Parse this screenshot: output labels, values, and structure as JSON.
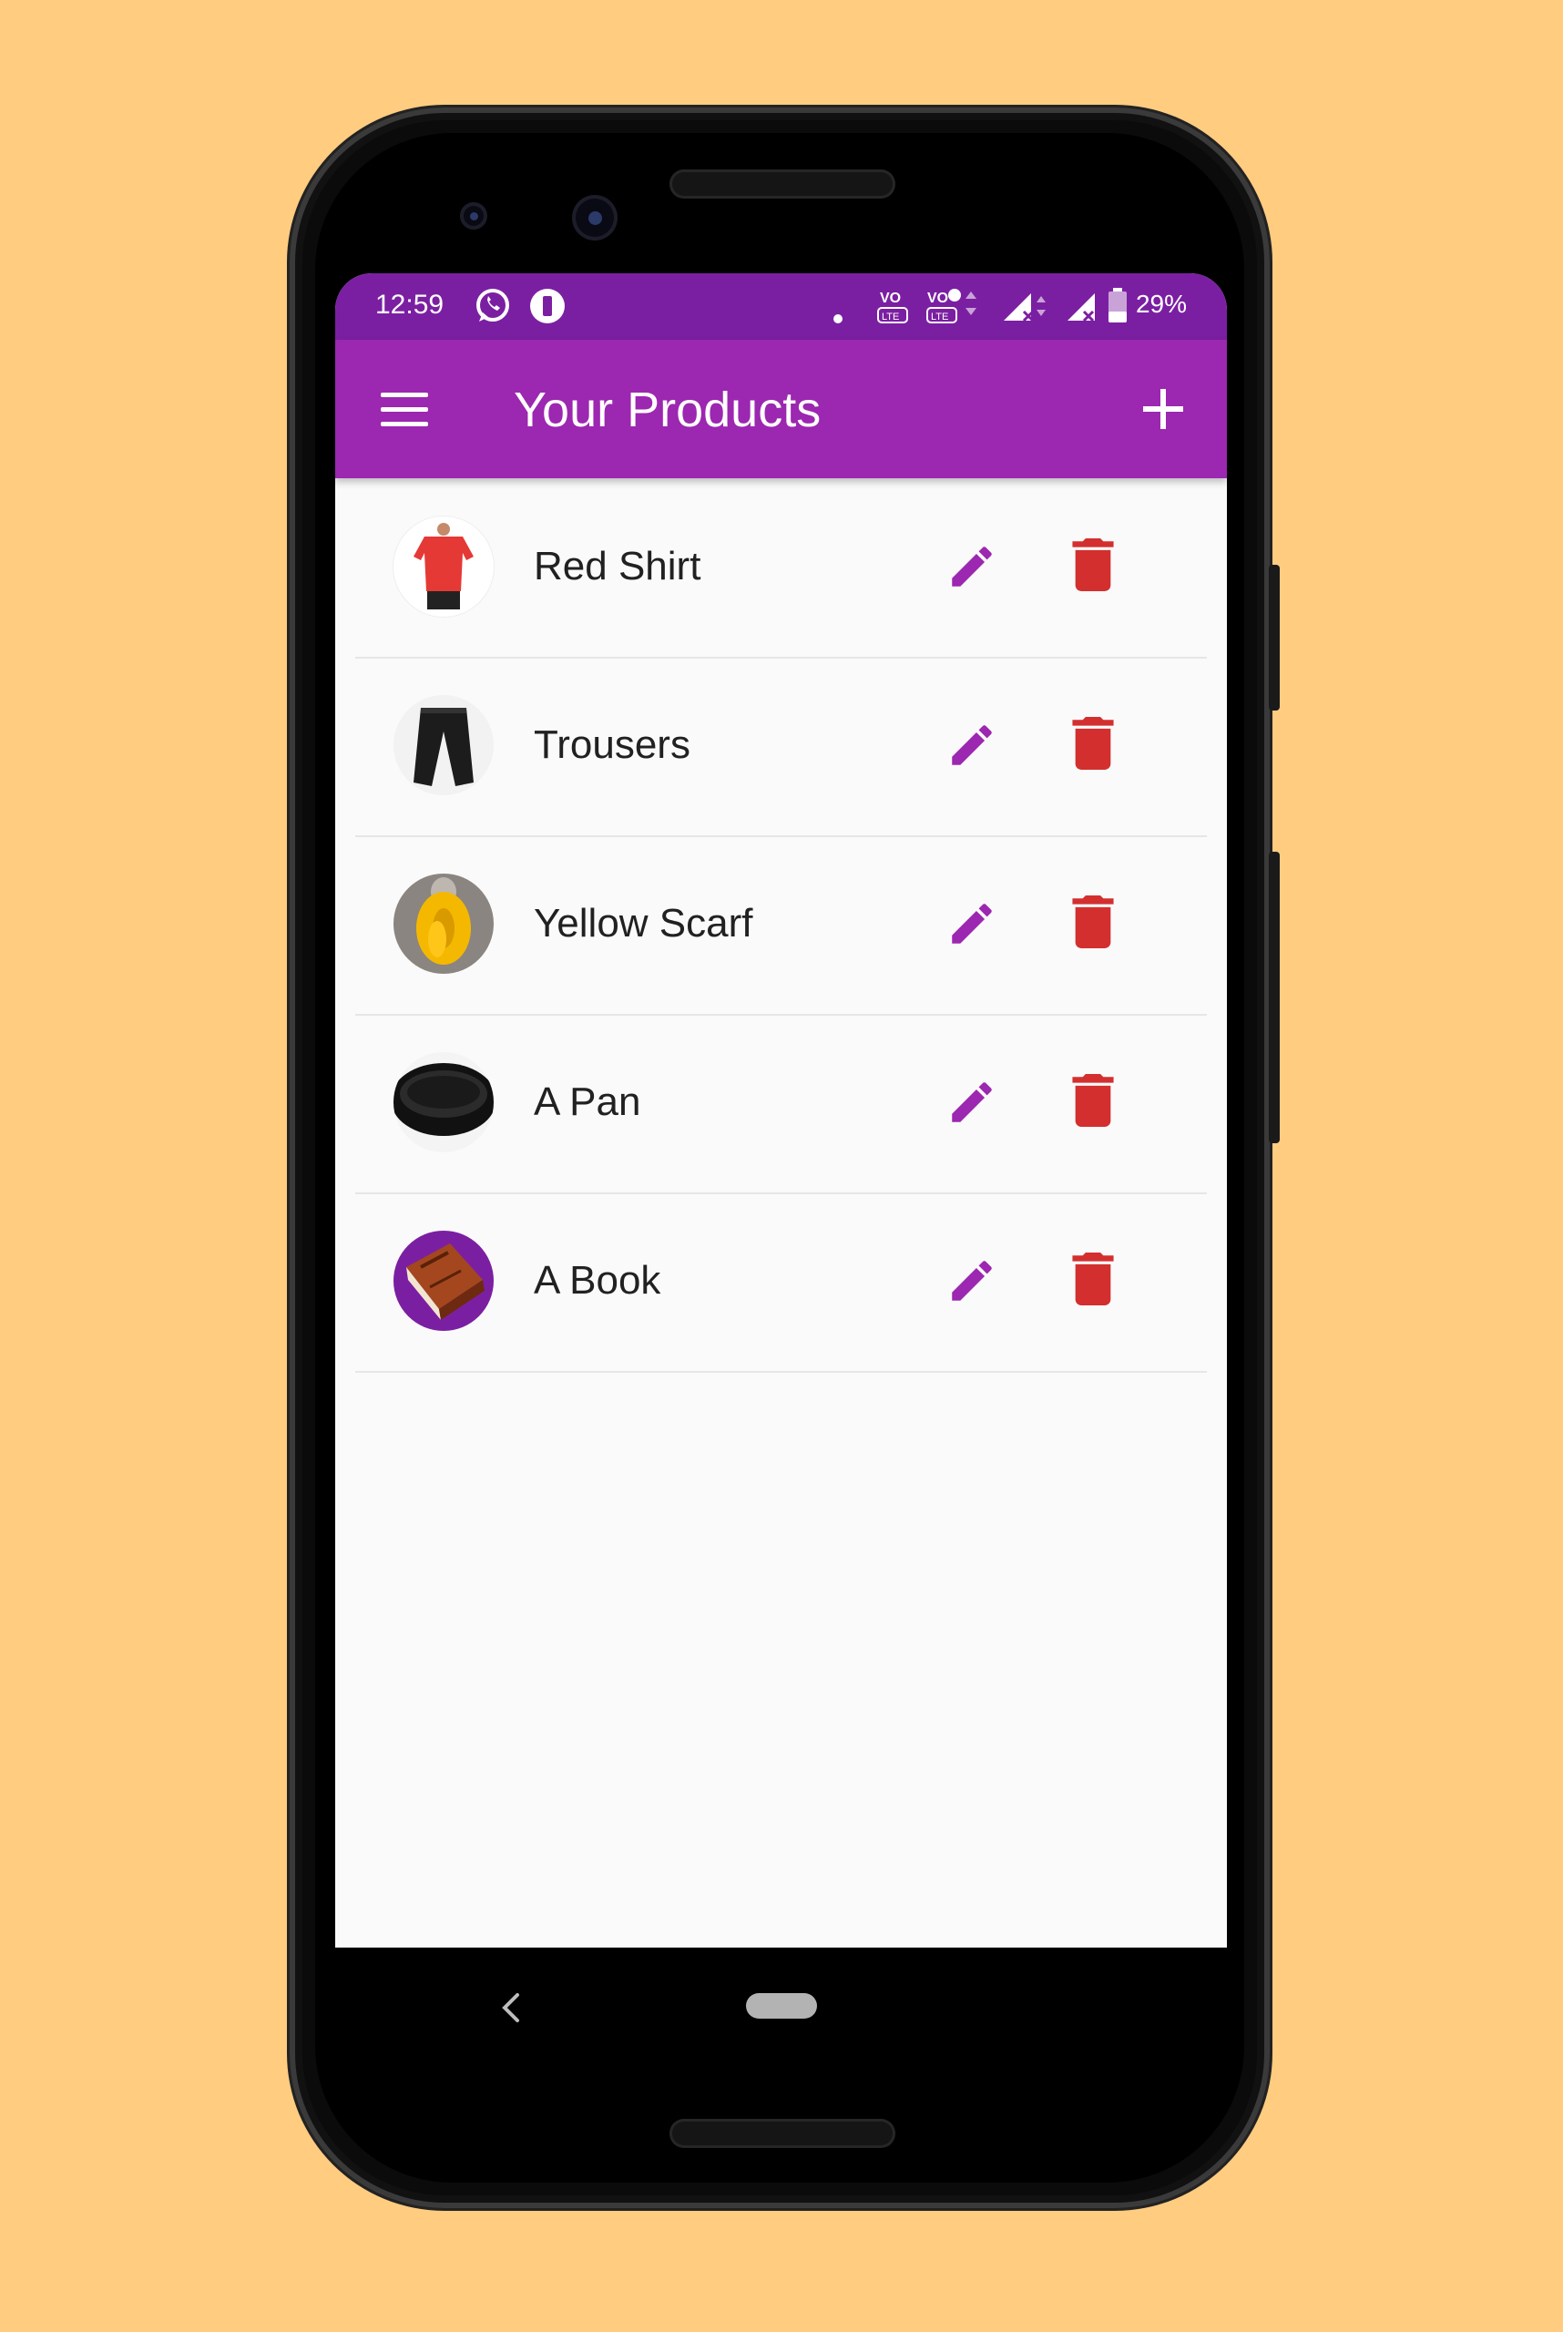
{
  "status_bar": {
    "time": "12:59",
    "battery": "29%",
    "icons": [
      "whatsapp-icon",
      "app-notification-icon",
      "dot-icon",
      "volte-icon",
      "volte2-icon",
      "signal-icon",
      "signal-icon-2",
      "battery-icon"
    ]
  },
  "app_bar": {
    "title": "Your Products",
    "menu_icon": "menu-icon",
    "add_icon": "add-icon"
  },
  "products": [
    {
      "title": "Red Shirt",
      "image": "red-shirt"
    },
    {
      "title": "Trousers",
      "image": "trousers"
    },
    {
      "title": "Yellow Scarf",
      "image": "yellow-scarf"
    },
    {
      "title": "A Pan",
      "image": "pan"
    },
    {
      "title": "A Book",
      "image": "book"
    }
  ],
  "colors": {
    "background": "#FFCC80",
    "primary": "#9C27B0",
    "primary_dark": "#7B1FA2",
    "edit_icon": "#9C27B0",
    "delete_icon": "#D32F2F"
  }
}
